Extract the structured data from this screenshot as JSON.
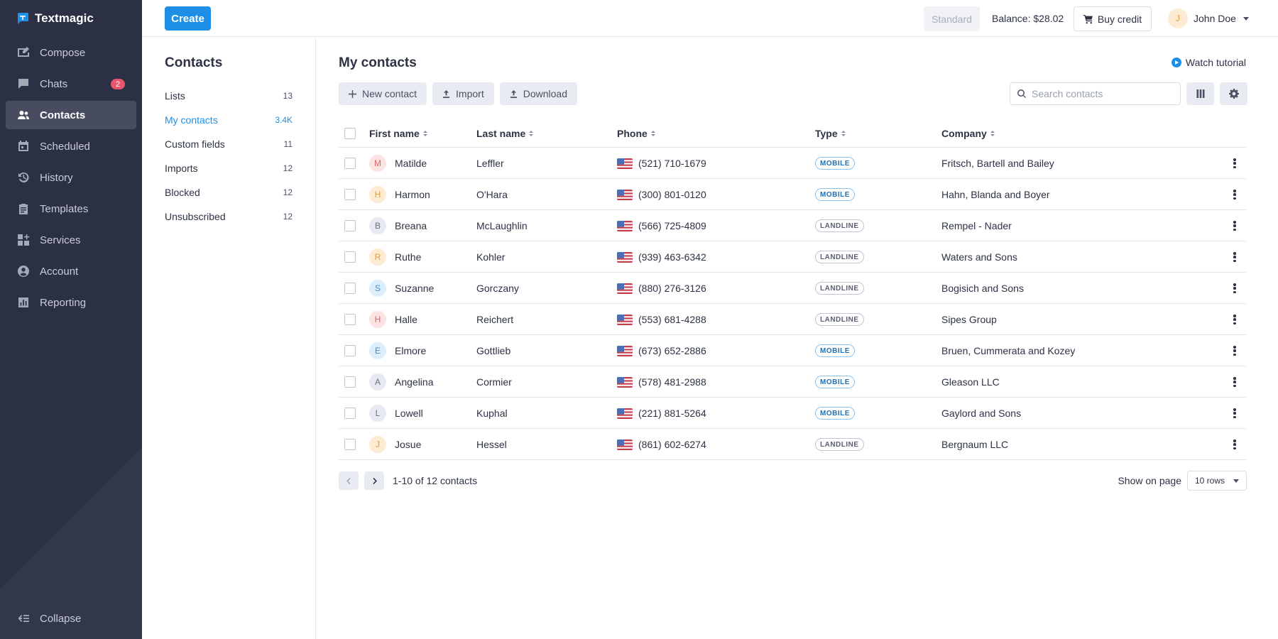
{
  "app": {
    "name": "Textmagic"
  },
  "sidebar": {
    "items": [
      {
        "label": "Compose",
        "icon": "compose-icon"
      },
      {
        "label": "Chats",
        "icon": "chat-icon",
        "badge": "2"
      },
      {
        "label": "Contacts",
        "icon": "contacts-icon",
        "active": true
      },
      {
        "label": "Scheduled",
        "icon": "calendar-icon"
      },
      {
        "label": "History",
        "icon": "history-icon"
      },
      {
        "label": "Templates",
        "icon": "clipboard-icon"
      },
      {
        "label": "Services",
        "icon": "grid-plus-icon"
      },
      {
        "label": "Account",
        "icon": "account-icon"
      },
      {
        "label": "Reporting",
        "icon": "bar-chart-icon"
      }
    ],
    "collapse_label": "Collapse"
  },
  "topbar": {
    "create_label": "Create",
    "plan": "Standard",
    "balance": "Balance: $28.02",
    "buy_label": "Buy credit",
    "user_initial": "J",
    "user_name": "John Doe"
  },
  "subnav": {
    "title": "Contacts",
    "items": [
      {
        "label": "Lists",
        "count": "13"
      },
      {
        "label": "My contacts",
        "count": "3.4K",
        "active": true
      },
      {
        "label": "Custom fields",
        "count": "11"
      },
      {
        "label": "Imports",
        "count": "12"
      },
      {
        "label": "Blocked",
        "count": "12"
      },
      {
        "label": "Unsubscribed",
        "count": "12"
      }
    ]
  },
  "main": {
    "title": "My contacts",
    "tutorial_label": "Watch tutorial",
    "actions": {
      "new_contact": "New contact",
      "import": "Import",
      "download": "Download"
    },
    "search_placeholder": "Search contacts"
  },
  "table": {
    "columns": [
      "First name",
      "Last name",
      "Phone",
      "Type",
      "Company"
    ],
    "rows": [
      {
        "initial": "M",
        "first": "Matilde",
        "last": "Leffler",
        "phone": "(521) 710-1679",
        "type": "MOBILE",
        "company": "Fritsch, Bartell and Bailey",
        "avatar_bg": "#fbe3e3",
        "avatar_fg": "#d96a6a"
      },
      {
        "initial": "H",
        "first": "Harmon",
        "last": "O'Hara",
        "phone": "(300) 801-0120",
        "type": "MOBILE",
        "company": "Hahn, Blanda and Boyer",
        "avatar_bg": "#fdebd3",
        "avatar_fg": "#e89a3c"
      },
      {
        "initial": "B",
        "first": "Breana",
        "last": "McLaughlin",
        "phone": "(566) 725-4809",
        "type": "LANDLINE",
        "company": "Rempel - Nader",
        "avatar_bg": "#e6e9f0",
        "avatar_fg": "#6b7286"
      },
      {
        "initial": "R",
        "first": "Ruthe",
        "last": "Kohler",
        "phone": "(939) 463-6342",
        "type": "LANDLINE",
        "company": "Waters and Sons",
        "avatar_bg": "#fdebd3",
        "avatar_fg": "#e89a3c"
      },
      {
        "initial": "S",
        "first": "Suzanne",
        "last": "Gorczany",
        "phone": "(880) 276-3126",
        "type": "LANDLINE",
        "company": "Bogisich and Sons",
        "avatar_bg": "#dceefc",
        "avatar_fg": "#3d8fd6"
      },
      {
        "initial": "H",
        "first": "Halle",
        "last": "Reichert",
        "phone": "(553) 681-4288",
        "type": "LANDLINE",
        "company": "Sipes Group",
        "avatar_bg": "#fbe3e3",
        "avatar_fg": "#d96a6a"
      },
      {
        "initial": "E",
        "first": "Elmore",
        "last": "Gottlieb",
        "phone": "(673) 652-2886",
        "type": "MOBILE",
        "company": "Bruen, Cummerata and Kozey",
        "avatar_bg": "#dceefc",
        "avatar_fg": "#3d8fd6"
      },
      {
        "initial": "A",
        "first": "Angelina",
        "last": "Cormier",
        "phone": "(578) 481-2988",
        "type": "MOBILE",
        "company": "Gleason LLC",
        "avatar_bg": "#e6e9f0",
        "avatar_fg": "#6b7286"
      },
      {
        "initial": "L",
        "first": "Lowell",
        "last": "Kuphal",
        "phone": "(221) 881-5264",
        "type": "MOBILE",
        "company": "Gaylord and Sons",
        "avatar_bg": "#e6e9f0",
        "avatar_fg": "#6b7286"
      },
      {
        "initial": "J",
        "first": "Josue",
        "last": "Hessel",
        "phone": "(861) 602-6274",
        "type": "LANDLINE",
        "company": "Bergnaum LLC",
        "avatar_bg": "#fdebd3",
        "avatar_fg": "#e89a3c"
      }
    ]
  },
  "pagination": {
    "summary": "1-10 of 12 contacts",
    "show_label": "Show on page",
    "rows_value": "10 rows"
  },
  "colors": {
    "accent": "#1e8fe6",
    "sidebar_bg": "#2b3045",
    "badge_red": "#e9566b"
  }
}
